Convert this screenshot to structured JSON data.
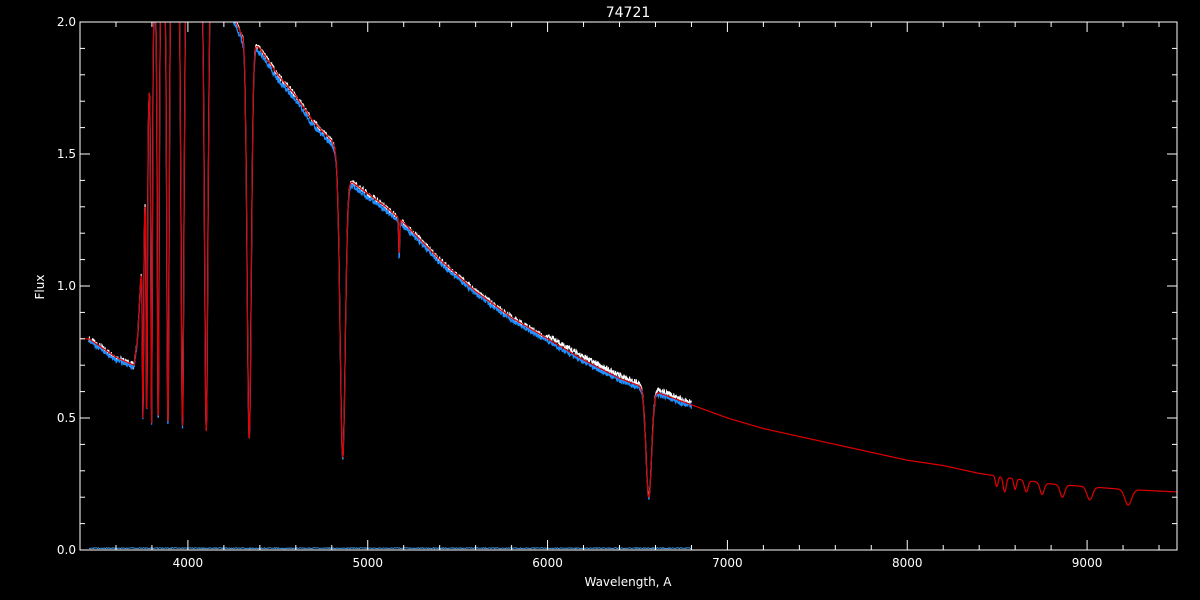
{
  "colors": {
    "background": "#000000",
    "axes": "#ffffff",
    "observed": "#ffffff",
    "observed_alt": "#1e90ff",
    "model": "#e00000",
    "error": "#3a8fd8"
  },
  "chart_data": {
    "type": "line",
    "title": "74721",
    "xlabel": "Wavelength, A",
    "ylabel": "Flux",
    "xlim": [
      3400,
      9500
    ],
    "ylim": [
      0.0,
      2.0
    ],
    "xticks": [
      4000,
      5000,
      6000,
      7000,
      8000,
      9000
    ],
    "yticks": [
      0.0,
      0.5,
      1.0,
      1.5,
      2.0
    ],
    "ytick_labels": [
      "0.0",
      "0.5",
      "1.0",
      "1.5",
      "2.0"
    ],
    "grid": false,
    "continuum": {
      "x": [
        3450,
        3600,
        3700,
        3720,
        3760,
        3800,
        3900,
        4000,
        4100,
        4200,
        4300,
        4400,
        4500,
        4600,
        4700,
        4800,
        4900,
        5000,
        5100,
        5200,
        5300,
        5400,
        5500,
        5600,
        5800,
        6000,
        6200,
        6400,
        6600,
        6800,
        7000,
        7200,
        7400,
        7600,
        7800,
        8000,
        8200,
        8400,
        8600,
        8800,
        9000,
        9200,
        9500
      ],
      "y": [
        0.8,
        0.73,
        0.7,
        0.8,
        1.3,
        2.0,
        2.2,
        2.2,
        2.2,
        2.1,
        1.95,
        1.9,
        1.8,
        1.72,
        1.62,
        1.55,
        1.4,
        1.35,
        1.3,
        1.24,
        1.17,
        1.1,
        1.04,
        0.98,
        0.88,
        0.8,
        0.72,
        0.65,
        0.6,
        0.55,
        0.5,
        0.46,
        0.43,
        0.4,
        0.37,
        0.34,
        0.32,
        0.29,
        0.27,
        0.25,
        0.24,
        0.23,
        0.22
      ]
    },
    "absorption_lines": [
      {
        "center": 3750,
        "width": 5,
        "min": 0.5
      },
      {
        "center": 3771,
        "width": 5,
        "min": 0.5
      },
      {
        "center": 3798,
        "width": 6,
        "min": 0.48
      },
      {
        "center": 3835,
        "width": 7,
        "min": 0.48
      },
      {
        "center": 3889,
        "width": 9,
        "min": 0.47
      },
      {
        "center": 3970,
        "width": 11,
        "min": 0.47
      },
      {
        "center": 4102,
        "width": 13,
        "min": 0.45
      },
      {
        "center": 4341,
        "width": 16,
        "min": 0.42
      },
      {
        "center": 4861,
        "width": 20,
        "min": 0.35
      },
      {
        "center": 5175,
        "width": 4,
        "min": 1.12
      },
      {
        "center": 6563,
        "width": 22,
        "min": 0.2
      }
    ],
    "model_ca_lines": [
      {
        "center": 8498,
        "width": 10,
        "min": 0.24
      },
      {
        "center": 8542,
        "width": 12,
        "min": 0.22
      },
      {
        "center": 8600,
        "width": 10,
        "min": 0.23
      },
      {
        "center": 8662,
        "width": 14,
        "min": 0.22
      },
      {
        "center": 8750,
        "width": 16,
        "min": 0.21
      },
      {
        "center": 8863,
        "width": 18,
        "min": 0.2
      },
      {
        "center": 9015,
        "width": 22,
        "min": 0.19
      },
      {
        "center": 9229,
        "width": 26,
        "min": 0.17
      }
    ],
    "series": [
      {
        "x_range": [
          3450,
          6800
        ],
        "color_key": "observed"
      },
      {
        "x_range": [
          3450,
          6800
        ],
        "color_key": "observed_alt"
      },
      {
        "x_range": [
          3400,
          9500
        ],
        "color_key": "model"
      },
      {
        "x_range": [
          3450,
          6800
        ],
        "color_key": "error",
        "flux_level": 0.005
      }
    ]
  }
}
